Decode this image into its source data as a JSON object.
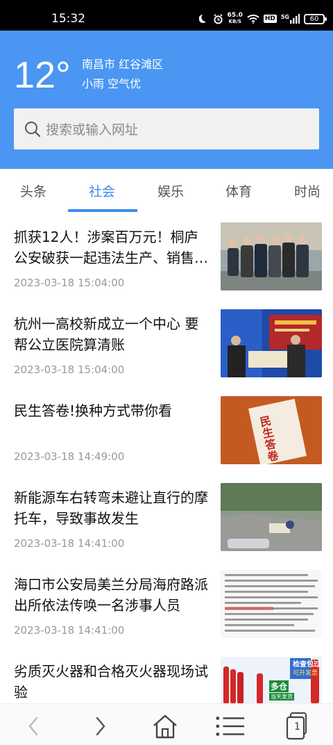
{
  "status_bar": {
    "time": "15:32",
    "net_speed_value": "65.0",
    "net_speed_unit": "KB/S",
    "battery": "60",
    "hd_label": "HD",
    "signal_label": "5G"
  },
  "weather": {
    "temperature": "12°",
    "location": "南昌市 红谷滩区",
    "condition": "小雨 空气优"
  },
  "search": {
    "placeholder": "搜索或输入网址"
  },
  "tabs": [
    {
      "label": "头条"
    },
    {
      "label": "社会"
    },
    {
      "label": "娱乐"
    },
    {
      "label": "体育"
    },
    {
      "label": "时尚"
    }
  ],
  "active_tab": "社会",
  "news": [
    {
      "title": "抓获12人！涉案百万元！桐庐公安破获一起违法生产、销售…",
      "date": "2023-03-18 15:04:00",
      "thumb": "group-photo-icon"
    },
    {
      "title": "杭州一高校新成立一个中心 要帮公立医院算清账",
      "date": "2023-03-18 15:04:00",
      "thumb": "ceremony-photo-icon"
    },
    {
      "title": "民生答卷!换种方式带你看",
      "date": "2023-03-18 14:49:00",
      "thumb": "book-cover-icon",
      "thumb_text": "民生答卷"
    },
    {
      "title": "新能源车右转弯未避让直行的摩托车，导致事故发生",
      "date": "2023-03-18 14:41:00",
      "thumb": "traffic-accident-icon"
    },
    {
      "title": "海口市公安局美兰分局海府路派出所依法传唤一名涉事人员",
      "date": "2023-03-18 14:41:00",
      "thumb": "document-screenshot-icon"
    },
    {
      "title": "劣质灭火器和合格灭火器现场试验",
      "date": "",
      "thumb": "extinguisher-ad-icon",
      "thumb_text_1": "检查包过",
      "thumb_text_2": "可开发票",
      "thumb_text_3": "多仓",
      "thumb_text_4": "当天发货"
    }
  ],
  "bottom_bar": {
    "tab_count": "1"
  },
  "colors": {
    "header_blue": "#4a96f2",
    "accent": "#3b8af0"
  }
}
